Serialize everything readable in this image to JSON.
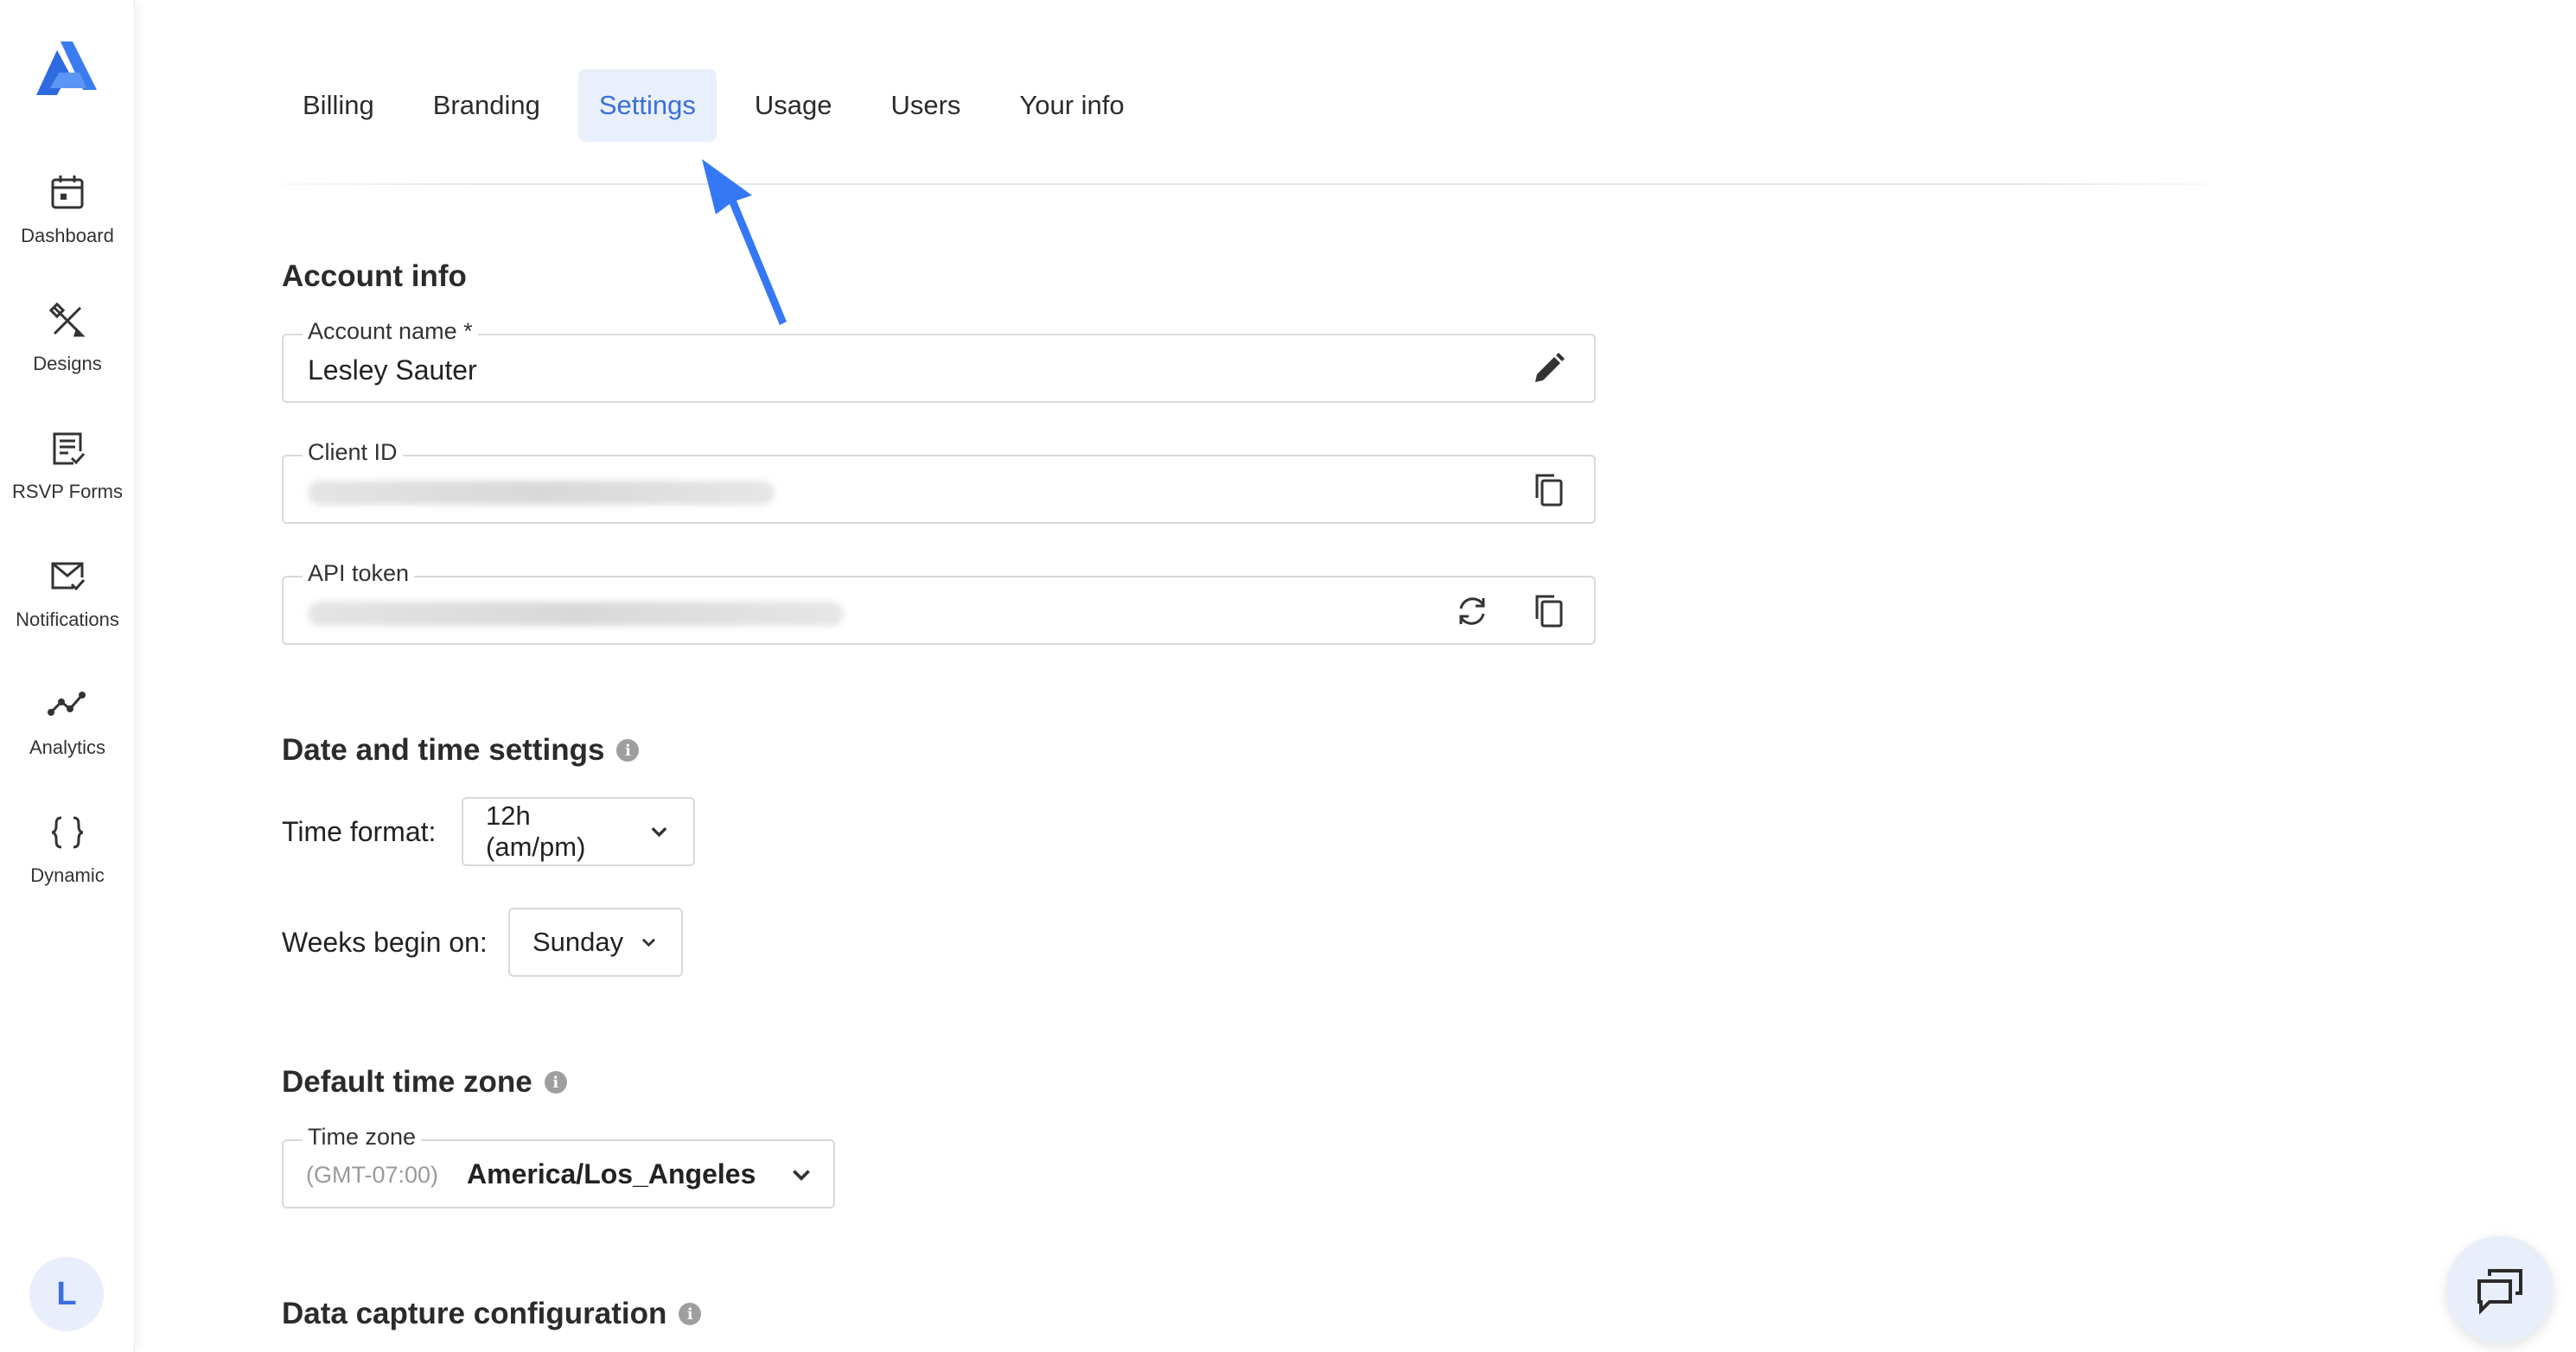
{
  "sidebar": {
    "items": [
      {
        "label": "Dashboard",
        "icon": "calendar-icon"
      },
      {
        "label": "Designs",
        "icon": "pencil-ruler-icon"
      },
      {
        "label": "RSVP Forms",
        "icon": "form-check-icon"
      },
      {
        "label": "Notifications",
        "icon": "envelope-check-icon"
      },
      {
        "label": "Analytics",
        "icon": "line-chart-icon"
      },
      {
        "label": "Dynamic",
        "icon": "curly-braces-icon"
      }
    ],
    "avatar_initial": "L"
  },
  "tabs": [
    {
      "label": "Billing",
      "active": false
    },
    {
      "label": "Branding",
      "active": false
    },
    {
      "label": "Settings",
      "active": true
    },
    {
      "label": "Usage",
      "active": false
    },
    {
      "label": "Users",
      "active": false
    },
    {
      "label": "Your info",
      "active": false
    }
  ],
  "account_info": {
    "title": "Account info",
    "account_name_label": "Account name *",
    "account_name_value": "Lesley Sauter",
    "client_id_label": "Client ID",
    "api_token_label": "API token"
  },
  "date_time": {
    "title": "Date and time settings",
    "time_format_label": "Time format:",
    "time_format_value": "12h (am/pm)",
    "weeks_begin_label": "Weeks begin on:",
    "weeks_begin_value": "Sunday"
  },
  "time_zone": {
    "title": "Default time zone",
    "label": "Time zone",
    "offset": "(GMT-07:00)",
    "value": "America/Los_Angeles"
  },
  "data_capture": {
    "title": "Data capture configuration"
  },
  "colors": {
    "accent": "#3a6fd8",
    "annotation_arrow": "#3478f6",
    "active_tab_bg": "#e9f0fb"
  }
}
